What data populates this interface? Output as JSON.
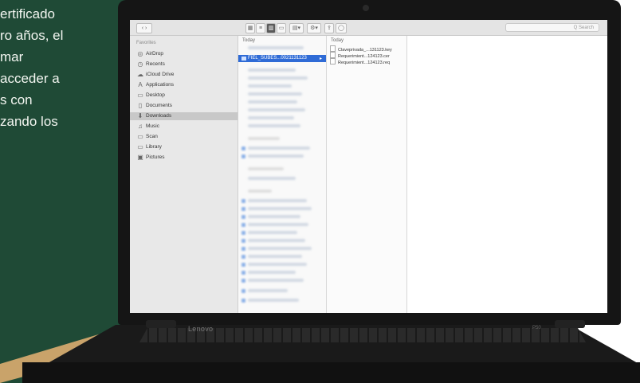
{
  "slide_text": {
    "line1": "ertificado",
    "line2": "ro años, el",
    "line3": "mar",
    "line4": "acceder a",
    "line5": "s con",
    "line6": "zando los"
  },
  "laptop": {
    "brand": "Lenovo",
    "model": "P50"
  },
  "finder": {
    "search_placeholder": "Q Search",
    "sidebar_header": "Favorites",
    "sidebar_items": [
      {
        "label": "AirDrop",
        "icon": "airdrop-icon"
      },
      {
        "label": "Recents",
        "icon": "clock-icon"
      },
      {
        "label": "iCloud Drive",
        "icon": "cloud-icon"
      },
      {
        "label": "Applications",
        "icon": "applications-icon"
      },
      {
        "label": "Desktop",
        "icon": "desktop-icon"
      },
      {
        "label": "Documents",
        "icon": "document-icon"
      },
      {
        "label": "Downloads",
        "icon": "download-icon"
      },
      {
        "label": "Music",
        "icon": "music-icon"
      },
      {
        "label": "Scan",
        "icon": "folder-icon"
      },
      {
        "label": "Library",
        "icon": "folder-icon"
      },
      {
        "label": "Pictures",
        "icon": "pictures-icon"
      }
    ],
    "col_header_left": "Today",
    "col_header_right": "Today",
    "selected_folder": "FIEL_SUBES...0021131123",
    "files": [
      "Claveprivada_...131123.key",
      "Requerimient...124123.cer",
      "Requerimient...124123.req"
    ]
  },
  "colors": {
    "slide_green": "#1f4a36",
    "selection_blue": "#2f6bd6",
    "stripe_gold": "#c9a36a"
  }
}
